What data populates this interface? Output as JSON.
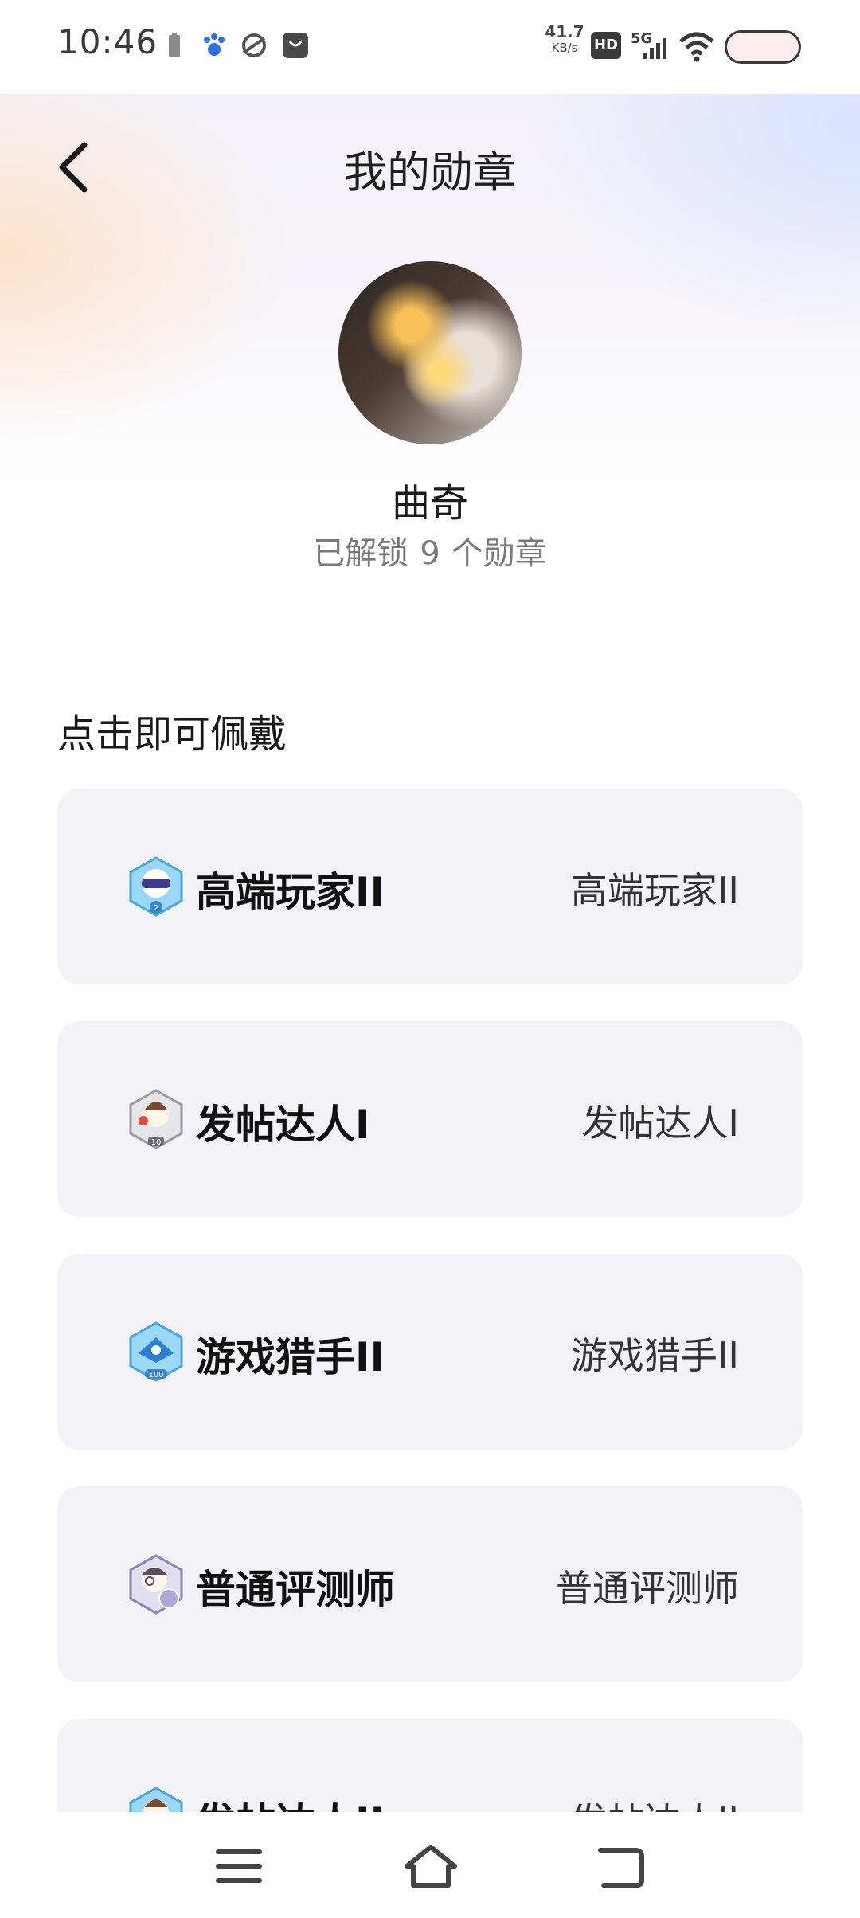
{
  "status_bar": {
    "time": "10:46",
    "net_speed_value": "41.7",
    "net_speed_unit": "KB/s",
    "hd_label": "HD",
    "network_label": "5G"
  },
  "header": {
    "title": "我的勋章"
  },
  "profile": {
    "name": "曲奇",
    "unlock_prefix": "已解锁",
    "unlock_count": "9",
    "unlock_suffix": "个勋章"
  },
  "section": {
    "label": "点击即可佩戴"
  },
  "badges": [
    {
      "name": "高端玩家II",
      "value": "高端玩家II",
      "icon": "vr-headset-badge-icon",
      "tag": "2",
      "color": "#6fc7f0"
    },
    {
      "name": "发帖达人I",
      "value": "发帖达人I",
      "icon": "poster-badge-icon",
      "tag": "10",
      "color": "#b8b8c0"
    },
    {
      "name": "游戏猎手II",
      "value": "游戏猎手II",
      "icon": "hunter-badge-icon",
      "tag": "100",
      "color": "#6fc7f0"
    },
    {
      "name": "普通评测师",
      "value": "普通评测师",
      "icon": "reviewer-badge-icon",
      "tag": "",
      "color": "#b0a8d8"
    },
    {
      "name": "发帖达人II",
      "value": "发帖达人II",
      "icon": "poster-badge-icon",
      "tag": "",
      "color": "#6fc7f0"
    }
  ]
}
